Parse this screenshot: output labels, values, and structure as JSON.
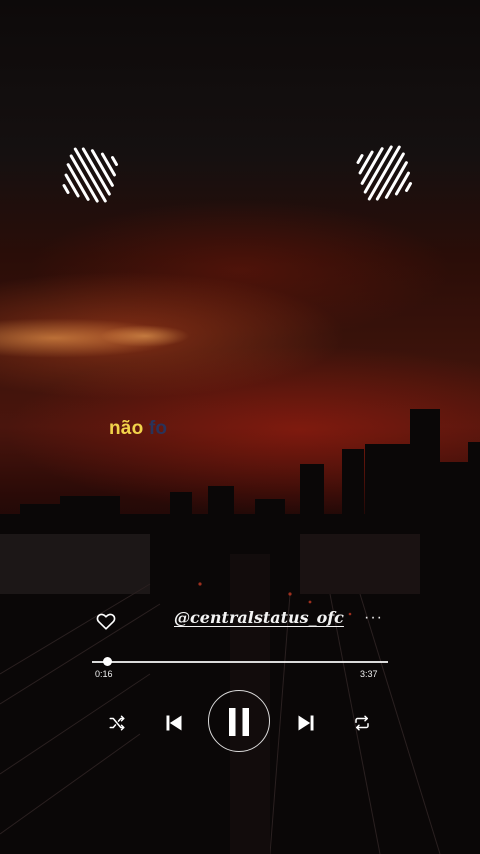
{
  "lyric": {
    "text": "não ",
    "fading_text": "fo"
  },
  "player": {
    "username": "@centralstatus_ofc",
    "elapsed": "0:16",
    "duration": "3:37",
    "progress_fraction": 0.054
  },
  "icons": {
    "like": "heart-icon",
    "more": "more-dots-icon",
    "shuffle": "shuffle-icon",
    "previous": "skip-previous-icon",
    "play_pause": "pause-icon",
    "next": "skip-next-icon",
    "repeat": "repeat-icon",
    "decor": "sound-wave-icon"
  },
  "colors": {
    "lyric": "#f1d34a",
    "lyric_fade": "#29335a",
    "controls": "#ffffff"
  }
}
